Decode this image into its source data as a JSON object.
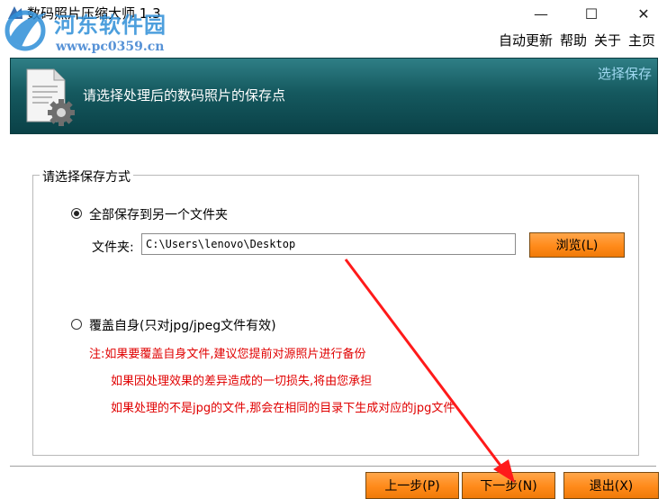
{
  "window": {
    "title": "数码照片压缩大师 1.3",
    "minimize_glyph": "—",
    "maximize_glyph": "☐",
    "close_glyph": "✕"
  },
  "watermark": {
    "name": "河东软件园",
    "url": "www.pc0359.cn"
  },
  "menu": {
    "items": [
      "自动更新",
      "帮助",
      "关于",
      "主页"
    ]
  },
  "banner": {
    "text": "请选择处理后的数码照片的保存点",
    "step_label": "选择保存"
  },
  "save_options": {
    "group_title": "请选择保存方式",
    "option1_label": "全部保存到另一个文件夹",
    "option1_selected": true,
    "folder_label": "文件夹:",
    "folder_value": "C:\\Users\\lenovo\\Desktop",
    "browse_label": "浏览(L)",
    "option2_label": "覆盖自身(只对jpg/jpeg文件有效)",
    "option2_selected": false,
    "notes": [
      "注:如果要覆盖自身文件,建议您提前对源照片进行备份",
      "如果因处理效果的差异造成的一切损失,将由您承担",
      "如果处理的不是jpg的文件,那会在相同的目录下生成对应的jpg文件"
    ]
  },
  "footer": {
    "prev_label": "上一步(P)",
    "next_label": "下一步(N)",
    "exit_label": "退出(X)"
  },
  "colors": {
    "banner_top": "#2f7f86",
    "banner_bottom": "#0a4147",
    "button_orange": "#ff8a1a",
    "note_red": "#e00000",
    "annotation_arrow": "#ff1a1a",
    "watermark_blue": "#2f8fd8"
  }
}
